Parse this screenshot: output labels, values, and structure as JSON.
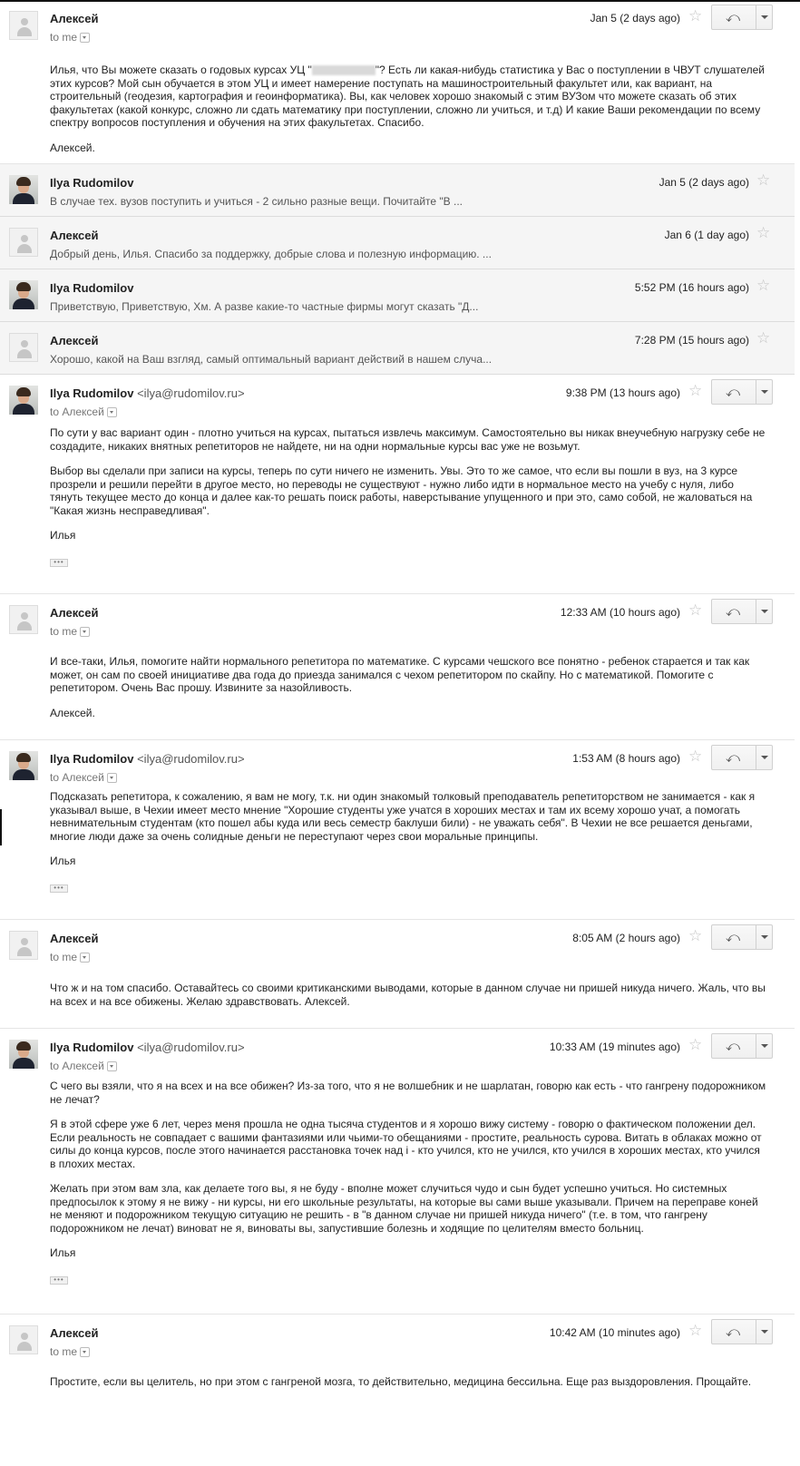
{
  "m1": {
    "sender": "Алексей",
    "to": "to me",
    "date": "Jan 5 (2 days ago)",
    "body_a": " Илья, что Вы можете сказать о годовых курсах УЦ \"",
    "body_b": "\"? Есть ли какая-нибудь статистика у Вас о поступлении в ЧВУТ слушателей этих курсов? Мой сын обучается в этом УЦ и имеет намерение поступать на машиностроительный факультет или, как вариант, на строительный (геодезия, картография и геоинформатика). Вы, как человек хорошо знакомый с этим ВУЗом что можете сказать об этих факультетах (какой конкурс, сложно ли сдать математику при поступлении, сложно ли учиться, и т.д) И какие Ваши рекомендации по всему спектру вопросов поступления и обучения на этих факультетах. Спасибо.",
    "sign": "Алексей."
  },
  "c1": {
    "sender": "Ilya Rudomilov",
    "date": "Jan 5 (2 days ago)",
    "snippet": "В случае тех. вузов поступить и учиться - 2 сильно разные вещи. Почитайте \"В ..."
  },
  "c2": {
    "sender": "Алексей",
    "date": "Jan 6 (1 day ago)",
    "snippet": "Добрый день, Илья. Спасибо за поддержку, добрые слова и полезную информацию. ..."
  },
  "c3": {
    "sender": "Ilya Rudomilov",
    "date": "5:52 PM (16 hours ago)",
    "snippet": "Приветствую, Приветствую, Хм. А разве какие-то частные фирмы могут сказать \"Д..."
  },
  "c4": {
    "sender": "Алексей",
    "date": "7:28 PM (15 hours ago)",
    "snippet": "Хорошо, какой на Ваш взгляд, самый оптимальный вариант действий в нашем случа..."
  },
  "m2": {
    "sender": "Ilya Rudomilov",
    "email": "<ilya@rudomilov.ru>",
    "to": "to Алексей",
    "date": "9:38 PM (13 hours ago)",
    "p1": "По сути у вас вариант один - плотно учиться на курсах, пытаться извлечь максимум. Самостоятельно вы никак внеучебную нагрузку себе не создадите, никаких внятных репетиторов не найдете, ни на одни нормальные курсы вас уже не возьмут.",
    "p2": "Выбор вы сделали при записи на курсы, теперь по сути ничего не изменить. Увы. Это то же самое, что если вы пошли в вуз, на 3 курсе прозрели и решили перейти в другое место, но переводы не существуют - нужно либо идти в нормальное место на учебу с нуля, либо тянуть текущее место до конца и далее как-то решать поиск работы, наверстывание упущенного и при это, само собой, не жаловаться на \"Какая жизнь несправедливая\".",
    "sign": "Илья",
    "dots": "•••"
  },
  "m3": {
    "sender": "Алексей",
    "to": "to me",
    "date": "12:33 AM (10 hours ago)",
    "p1": "И все-таки, Илья, помогите найти нормального репетитора по математике. С курсами чешского все понятно - ребенок старается и так как может, он сам по своей инициативе два года до приезда занимался с чехом репетитором по скайпу. Но с математикой. Помогите с репетитором. Очень Вас прошу. Извините за назойливость.",
    "sign": "Алексей."
  },
  "m4": {
    "sender": "Ilya Rudomilov",
    "email": "<ilya@rudomilov.ru>",
    "to": "to Алексей",
    "date": "1:53 AM (8 hours ago)",
    "p1": "Подсказать репетитора, к сожалению, я вам не могу, т.к. ни один знакомый толковый преподаватель репетиторством не занимается - как я указывал выше, в Чехии имеет место мнение \"Хорошие студенты уже учатся в хороших местах и там их всему хорошо учат, а помогать невнимательным студентам (кто пошел абы куда или весь семестр баклуши били) - не уважать себя\". В Чехии не все решается деньгами, многие люди даже за очень солидные деньги не переступают через свои моральные принципы.",
    "sign": "Илья",
    "dots": "•••"
  },
  "m5": {
    "sender": "Алексей",
    "to": "to me",
    "date": "8:05 AM (2 hours ago)",
    "p1": "Что ж и на том спасибо. Оставайтесь со своими критиканскими выводами, которые в данном случае ни пришей никуда ничего. Жаль, что вы на всех и на все обижены. Желаю здравствовать. Алексей."
  },
  "m6": {
    "sender": "Ilya Rudomilov",
    "email": "<ilya@rudomilov.ru>",
    "to": "to Алексей",
    "date": "10:33 AM (19 minutes ago)",
    "p1": "С чего вы взяли, что я на всех и на все обижен? Из-за того, что я не волшебник и не шарлатан, говорю как есть - что гангрену подорожником не лечат?",
    "p2": "Я в этой сфере уже 6 лет, через меня прошла не одна тысяча студентов и я хорошо вижу систему - говорю о фактическом положении дел. Если реальность не совпадает с вашими фантазиями или чьими-то обещаниями - простите, реальность сурова. Витать в облаках можно от силы до конца курсов, после этого начинается расстановка точек над i - кто учился, кто не учился, кто учился в хороших местах, кто учился в плохих местах.",
    "p3": "Желать при этом вам зла, как делаете того вы, я не буду - вполне может случиться чудо и сын будет успешно учиться. Но системных предпосылок к этому я не вижу - ни курсы, ни его школьные результаты, на которые вы сами выше указывали. Причем на переправе коней не меняют и подорожником текущую ситуацию не решить - в \"в данном случае ни пришей никуда ничего\" (т.е. в том, что гангрену подорожником не лечат) виноват не я, виноваты вы, запустившие болезнь и ходящие по целителям вместо больниц.",
    "sign": "Илья",
    "dots": "•••"
  },
  "m7": {
    "sender": "Алексей",
    "to": "to me",
    "date": "10:42 AM (10 minutes ago)",
    "p1": "Простите, если вы целитель, но при этом с гангреной мозга, то действительно, медицина бессильна. Еще раз выздоровления. Прощайте."
  },
  "icons": {
    "star": "☆",
    "reply": "⤺"
  }
}
